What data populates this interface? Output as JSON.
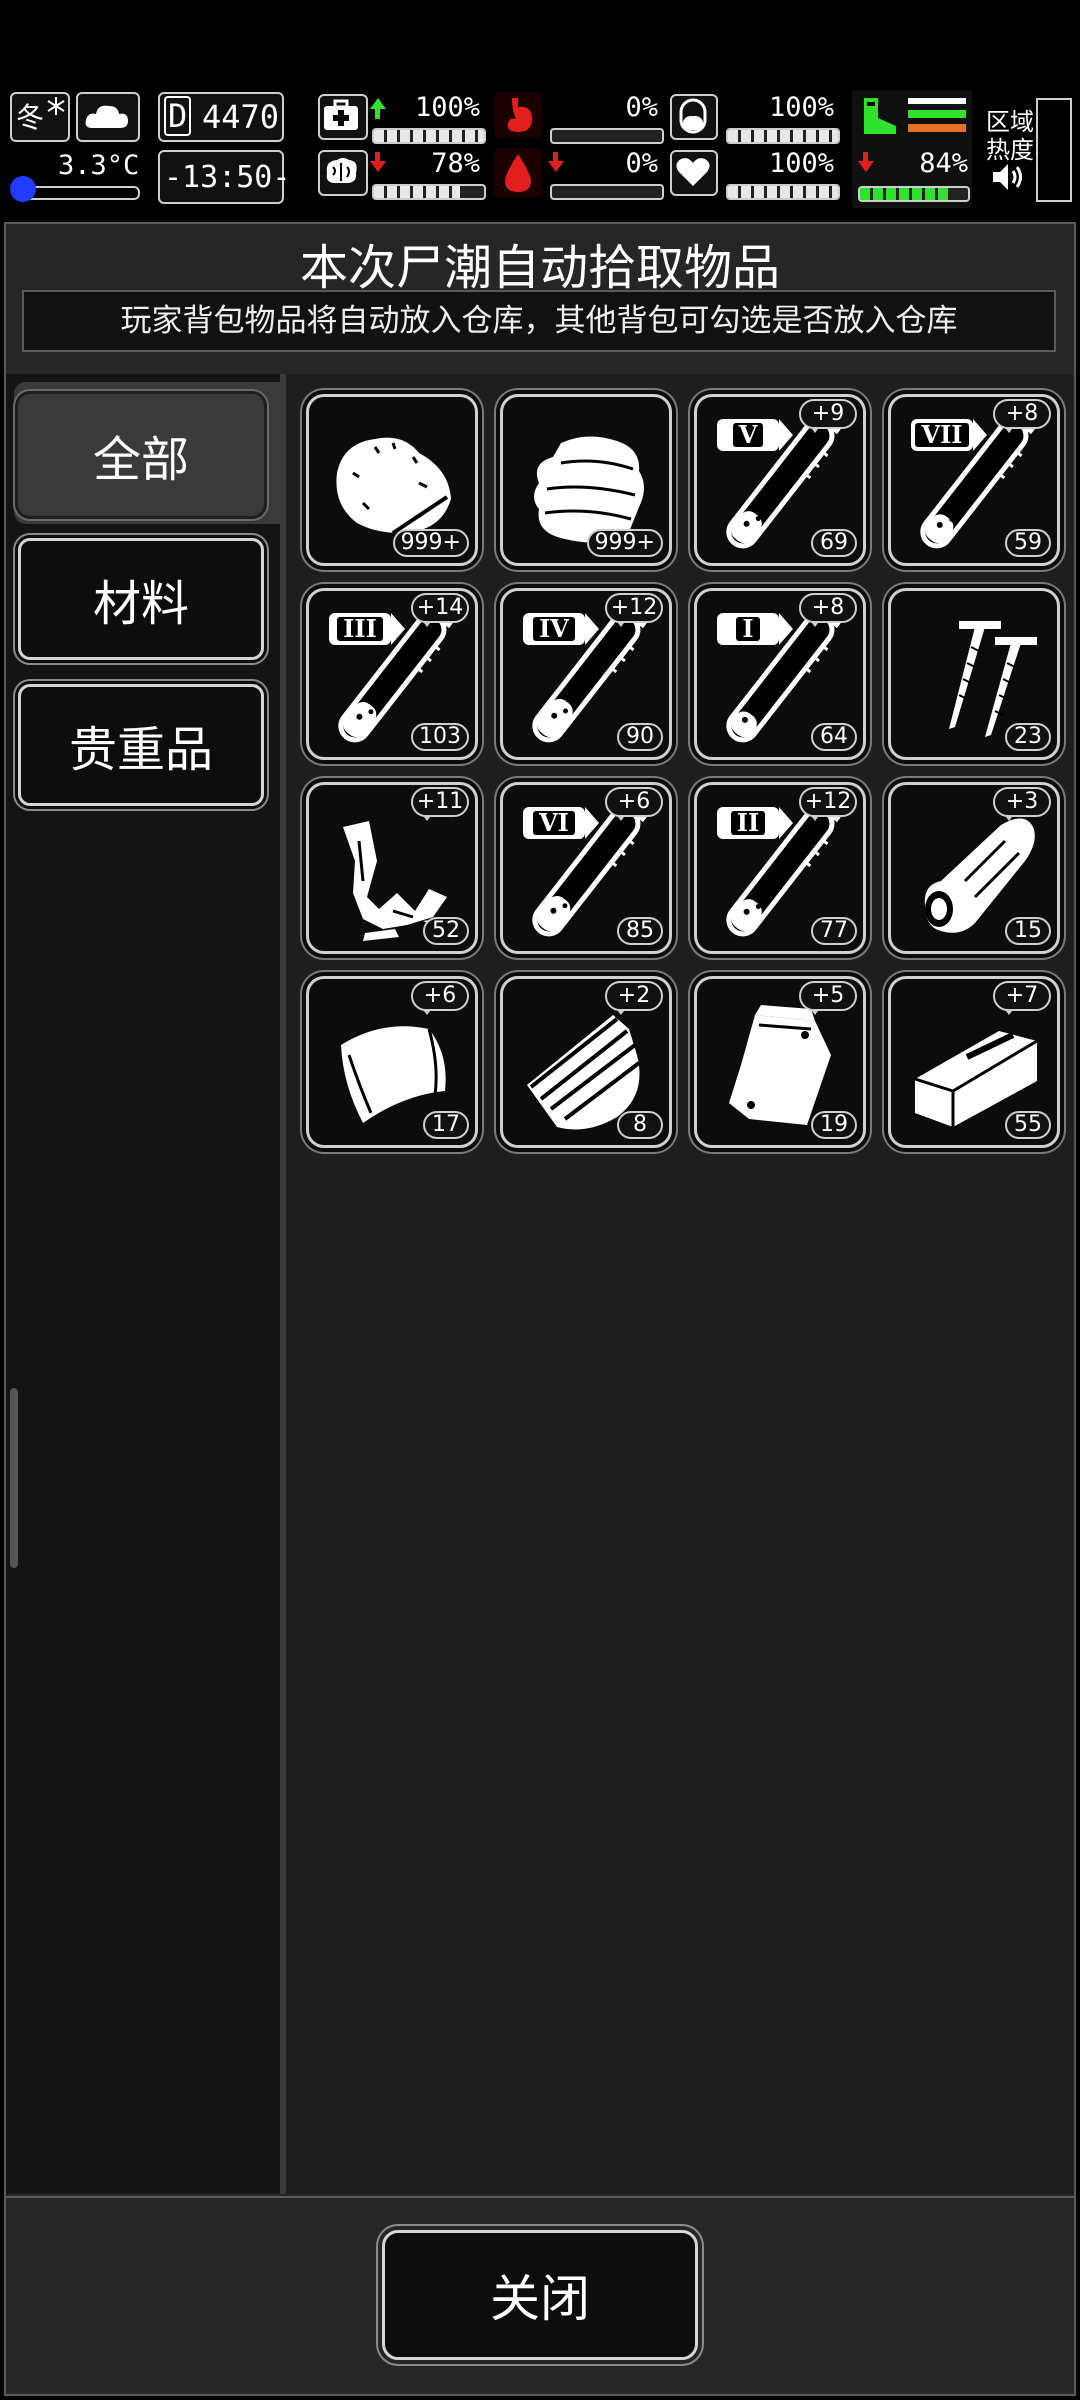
{
  "hud": {
    "season": "冬",
    "temperature": "3.3°C",
    "day_counter": "4470",
    "day_prefix": "D",
    "clock": "-13:50-",
    "health_pct": "100%",
    "brain_pct": "78%",
    "hunger_pct": "0%",
    "blood_pct": "0%",
    "pill_pct": "100%",
    "heart_pct": "100%",
    "stamina_pct": "84%",
    "zone_heat_label_1": "区域",
    "zone_heat_label_2": "热度",
    "colors": {
      "up": "#2ee22e",
      "down": "#e21f1f",
      "stamina_fill": "#2ee22e",
      "accent_orange": "#e8702a"
    }
  },
  "panel": {
    "title": "本次尸潮自动拾取物品",
    "subtitle": "玩家背包物品将自动放入仓库，其他背包可勾选是否放入仓库"
  },
  "categories": [
    {
      "label": "全部",
      "active": true
    },
    {
      "label": "材料",
      "active": false
    },
    {
      "label": "贵重品",
      "active": false
    }
  ],
  "items": [
    {
      "icon": "meat-icon",
      "count": "999+",
      "bonus": ""
    },
    {
      "icon": "cloth-icon",
      "count": "999+",
      "bonus": ""
    },
    {
      "icon": "test-tube-icon",
      "roman": "V",
      "count": "69",
      "bonus": "+9",
      "fill": 0.4
    },
    {
      "icon": "test-tube-icon",
      "roman": "VII",
      "count": "59",
      "bonus": "+8",
      "fill": 0.35
    },
    {
      "icon": "test-tube-icon",
      "roman": "III",
      "count": "103",
      "bonus": "+14",
      "fill": 0.45
    },
    {
      "icon": "test-tube-icon",
      "roman": "IV",
      "count": "90",
      "bonus": "+12",
      "fill": 0.5
    },
    {
      "icon": "test-tube-icon",
      "roman": "I",
      "count": "64",
      "bonus": "+8",
      "fill": 0.3
    },
    {
      "icon": "nails-icon",
      "count": "23",
      "bonus": ""
    },
    {
      "icon": "scrap-cloth-icon",
      "count": "52",
      "bonus": "+11"
    },
    {
      "icon": "test-tube-icon",
      "roman": "VI",
      "count": "85",
      "bonus": "+6",
      "fill": 0.45
    },
    {
      "icon": "test-tube-icon",
      "roman": "II",
      "count": "77",
      "bonus": "+12",
      "fill": 0.4
    },
    {
      "icon": "leather-roll-icon",
      "count": "15",
      "bonus": "+3"
    },
    {
      "icon": "plastic-sheet-icon",
      "count": "17",
      "bonus": "+6"
    },
    {
      "icon": "plank-bundle-icon",
      "count": "8",
      "bonus": "+2"
    },
    {
      "icon": "pouch-icon",
      "count": "19",
      "bonus": "+5"
    },
    {
      "icon": "box-icon",
      "count": "55",
      "bonus": "+7"
    }
  ],
  "close_label": "关闭"
}
